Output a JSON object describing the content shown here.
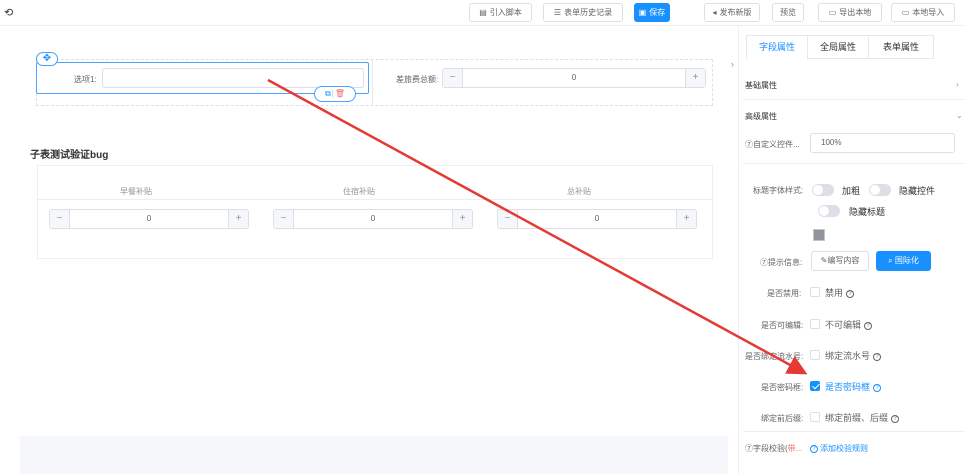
{
  "toolbar": {
    "back_icon": "arrow-left-icon",
    "buttons": [
      {
        "label": "引入脚本",
        "icon": "file-icon"
      },
      {
        "label": "表单历史记录",
        "icon": "history-icon"
      },
      {
        "label": "保存",
        "icon": "save-icon"
      },
      {
        "label": "发布新版",
        "icon": "send-icon"
      },
      {
        "label": "预览",
        "icon": ""
      },
      {
        "label": "导出本地",
        "icon": "export-icon"
      },
      {
        "label": "本地导入",
        "icon": "import-icon"
      }
    ],
    "primary_color": "#1890ff"
  },
  "canvas": {
    "field1_label": "选项1:",
    "field2_label": "差旅费总额:",
    "field2_value": "0",
    "subtable_title": "子表测试验证bug",
    "subtable_columns": [
      "早餐补贴",
      "住宿补贴",
      "总补贴"
    ],
    "subtable_values": [
      "0",
      "0",
      "0"
    ],
    "stepper_minus": "−",
    "stepper_plus": "+"
  },
  "panel": {
    "tabs": [
      "字段属性",
      "全局属性",
      "表单属性"
    ],
    "active_tab": "字段属性",
    "sections": {
      "basic": "基础属性",
      "advanced": "高级属性"
    },
    "custom_width_label": "⑦自定义控件...",
    "custom_width_value": "100%",
    "title_style_label": "标题字体样式:",
    "bold_label": "加粗",
    "hide_control_label": "隐藏控件",
    "hide_title_label": "隐藏标题",
    "tip_label": "⑦提示信息:",
    "edit_content_label": "编写内容",
    "i18n_label": "国际化",
    "disabled_label": "是否禁用:",
    "disabled_text": "禁用",
    "editable_label": "是否可编辑:",
    "editable_text": "不可编辑",
    "serial_label": "是否绑定流水号:",
    "serial_text": "绑定流水号",
    "password_label": "是否密码框:",
    "password_text": "是否密码框",
    "password_checked": true,
    "prefix_label": "绑定前后缀:",
    "prefix_text": "绑定前缀、后缀",
    "validation_label_a": "⑦字段校验(",
    "validation_label_b": "带...",
    "add_rule_label": "添加校验规则"
  }
}
